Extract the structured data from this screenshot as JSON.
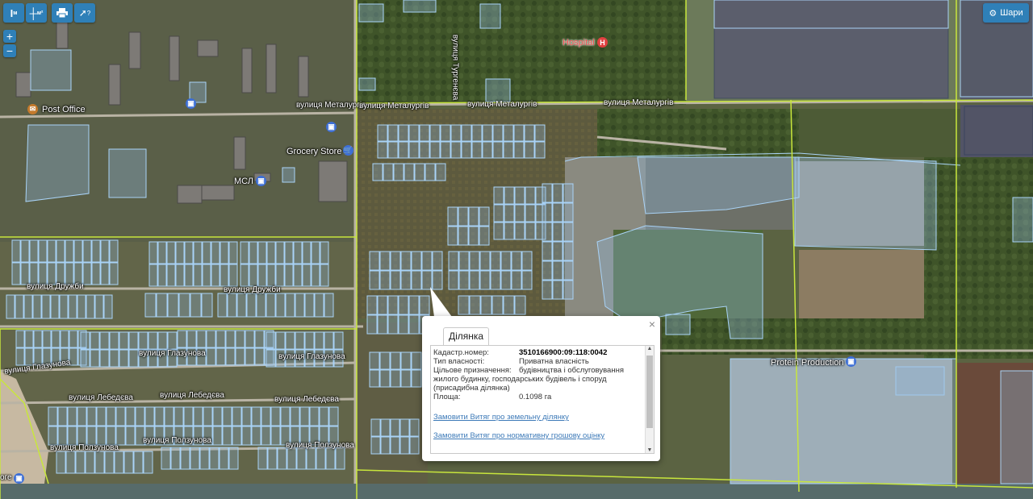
{
  "toolbar": {
    "ruler_label": "м",
    "area_label": "м²",
    "print_icon": "printer-icon",
    "identify_label": "?",
    "layers_label": "Шари"
  },
  "zoom": {
    "plus": "+",
    "minus": "−"
  },
  "map_labels": {
    "hospital": "Hospital",
    "hospital_marker": "H",
    "post_office": "Post Office",
    "grocery": "Grocery Store",
    "msl": "МСЛ",
    "protein": "Protein Production",
    "street_turgeneva": "вулиця Тургенєва",
    "street_metalurhiv_1": "вулиця Металургів",
    "street_metalurhiv_2": "вулиця Металургів",
    "street_metalurhiv_3": "вулиця Металургів",
    "street_metalurhiv_4": "вулиця Металургів",
    "street_druzhby_1": "вулиця Дружби",
    "street_druzhby_2": "вулиця Дружби",
    "street_hlazunova_1": "вулиця Глазунова",
    "street_hlazunova_2": "вулиця Глазунова",
    "street_hlazunova_3": "вулиця Глазунова",
    "street_lebedieva_1": "вулиця Лебедєва",
    "street_lebedieva_2": "вулиця Лебедєва",
    "street_lebedieva_3": "вулиця Лебедєва",
    "street_polzunova_1": "вулиця Ползунова",
    "street_polzunova_2": "вулиця Ползунова",
    "street_polzunova_3": "вулиця Ползунова",
    "fragment_ore": "оге"
  },
  "popup": {
    "tab": "Ділянка",
    "close": "×",
    "fields": [
      {
        "key": "Кадастр.номер:",
        "value": "3510166900:09:118:0042"
      },
      {
        "key": "Тип власності:",
        "value": "Приватна власність"
      },
      {
        "key": "Цільове призначення:",
        "value": "будівництва і обслуговування"
      },
      {
        "key": "",
        "value": "жилого будинку, господарських будівель і споруд"
      },
      {
        "key": "",
        "value": "(присадибна ділянка)"
      },
      {
        "key": "Площа:",
        "value": "0.1098 га"
      }
    ],
    "link1": "Замовити Витяг про земельну ділянку",
    "link2": "Замовити Витяг про нормативну грошову оцінку"
  },
  "colors": {
    "parcel": "#9cc8f0",
    "boundary": "#c8e63c",
    "accent": "#2f80b8"
  }
}
